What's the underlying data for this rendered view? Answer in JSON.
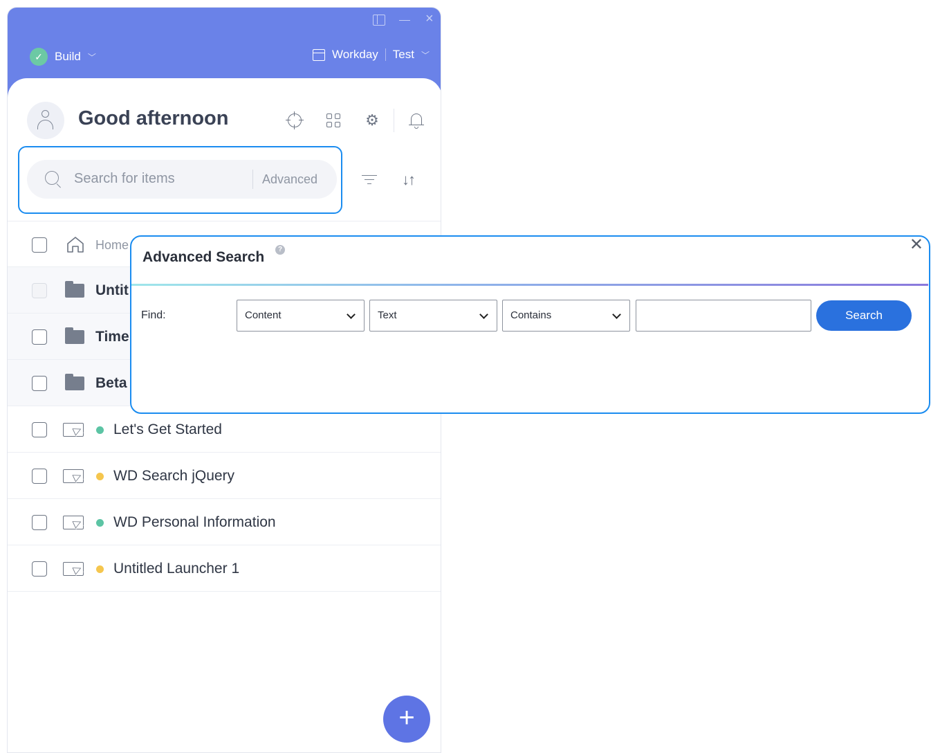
{
  "window": {
    "mode_label": "Build",
    "environment": "Workday",
    "environment_sub": "Test"
  },
  "header": {
    "greeting": "Good afternoon"
  },
  "search": {
    "placeholder": "Search for items",
    "advanced_label": "Advanced"
  },
  "list": {
    "home_label": "Home",
    "folders": [
      {
        "label": "Untit"
      },
      {
        "label": "Time"
      },
      {
        "label": "Beta"
      }
    ],
    "launchers": [
      {
        "label": "Let's Get Started",
        "status_color": "#5cc4a4"
      },
      {
        "label": "WD Search jQuery",
        "status_color": "#f5c64e"
      },
      {
        "label": "WD Personal Information",
        "status_color": "#5cc4a4"
      },
      {
        "label": "Untitled Launcher 1",
        "status_color": "#f5c64e"
      }
    ]
  },
  "fab": {
    "icon": "plus-icon",
    "glyph": "+"
  },
  "advanced_search": {
    "title": "Advanced Search",
    "help_glyph": "?",
    "find_label": "Find:",
    "field_select": "Content",
    "type_select": "Text",
    "operator_select": "Contains",
    "value": "",
    "search_button": "Search"
  },
  "colors": {
    "header_bg": "#6a82e8",
    "highlight": "#1a8cf0",
    "primary_button": "#2a71de",
    "fab": "#5e74e4"
  }
}
